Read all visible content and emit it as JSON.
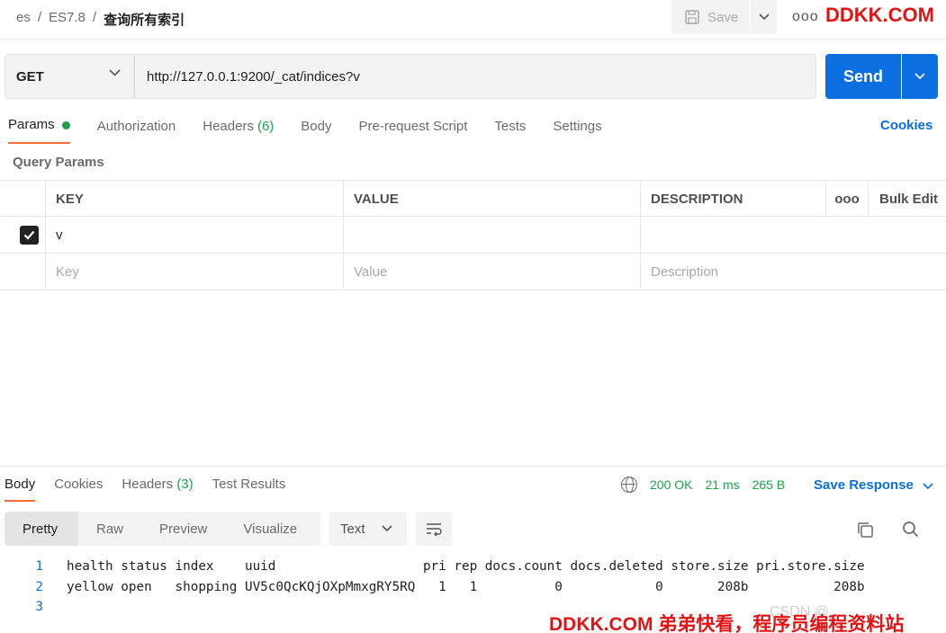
{
  "breadcrumb": [
    "es",
    "ES7.8",
    "查询所有索引"
  ],
  "breadcrumb_sep": "/",
  "toolbar": {
    "save_label": "Save",
    "more": "ooo"
  },
  "watermark": {
    "top": "DDKK.COM",
    "bottom": "DDKK.COM 弟弟快看，程序员编程资料站",
    "faint": "CSDN @"
  },
  "request": {
    "method": "GET",
    "url": "http://127.0.0.1:9200/_cat/indices?v",
    "send_label": "Send"
  },
  "req_tabs": {
    "params": "Params",
    "authorization": "Authorization",
    "headers": "Headers",
    "headers_count": "(6)",
    "body": "Body",
    "prerequest": "Pre-request Script",
    "tests": "Tests",
    "settings": "Settings",
    "cookies": "Cookies"
  },
  "query_params": {
    "title": "Query Params",
    "headers": {
      "key": "KEY",
      "value": "VALUE",
      "description": "DESCRIPTION",
      "more": "ooo",
      "bulk_edit": "Bulk Edit"
    },
    "rows": [
      {
        "checked": true,
        "key": "v",
        "value": "",
        "description": ""
      }
    ],
    "placeholder": {
      "key": "Key",
      "value": "Value",
      "description": "Description"
    }
  },
  "response": {
    "tabs": {
      "body": "Body",
      "cookies": "Cookies",
      "headers": "Headers",
      "headers_count": "(3)",
      "test_results": "Test Results"
    },
    "status": "200 OK",
    "time": "21 ms",
    "size": "265 B",
    "save_response": "Save Response",
    "formats": [
      "Pretty",
      "Raw",
      "Preview",
      "Visualize"
    ],
    "text_type": "Text",
    "lines": [
      {
        "n": "1",
        "text": "health status index    uuid                   pri rep docs.count docs.deleted store.size pri.store.size"
      },
      {
        "n": "2",
        "text": "yellow open   shopping UV5c0QcKQjOXpMmxgRY5RQ   1   1          0            0       208b           208b"
      },
      {
        "n": "3",
        "text": ""
      }
    ]
  },
  "colors": {
    "accent_blue": "#0b6fe0",
    "tab_orange": "#ff6c37",
    "status_green": "#1aa34a",
    "watermark_red": "#e01414"
  }
}
